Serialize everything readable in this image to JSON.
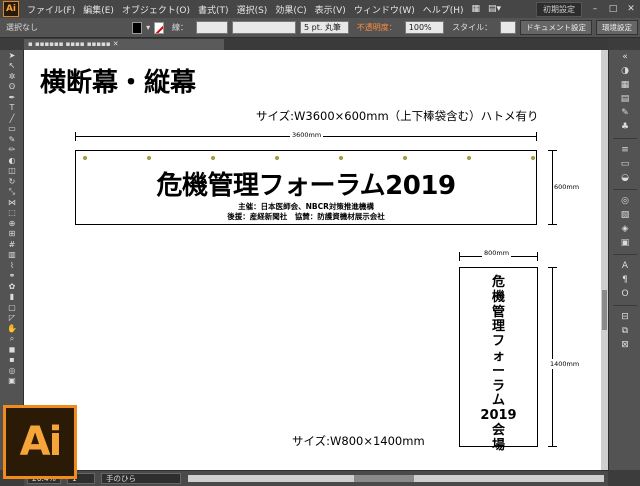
{
  "app": {
    "logo": "Ai"
  },
  "menu": {
    "items": [
      "ファイル(F)",
      "編集(E)",
      "オブジェクト(O)",
      "書式(T)",
      "選択(S)",
      "効果(C)",
      "表示(V)",
      "ウィンドウ(W)",
      "ヘルプ(H)"
    ],
    "workspace": "初期設定"
  },
  "control": {
    "selection": "選択なし",
    "stroke_label": "線：",
    "brush": "5 pt. 丸筆",
    "opacity_label": "不透明度：",
    "opacity": "100%",
    "style_label": "スタイル：",
    "doc_setup": "ドキュメント設定",
    "prefs": "環境設定"
  },
  "status": {
    "zoom": "26.4%",
    "page": "1",
    "tool": "手のひら"
  },
  "artwork": {
    "section_title": "横断幕・縦幕",
    "horizontal": {
      "size_label": "サイズ:W3600×600mm（上下棒袋含む）ハトメ有り",
      "width_dim": "3600mm",
      "height_dim": "600mm",
      "main": "危機管理フォーラム2019",
      "line1": "主催：日本医師会、NBCR対策推進機構",
      "line2": "後援：産経新聞社　協賛：防護資機材展示会社"
    },
    "vertical": {
      "width_dim": "800mm",
      "height_dim": "1400mm",
      "chars": [
        "危",
        "機",
        "管",
        "理",
        "フ",
        "ォ",
        "ー",
        "ラ",
        "ム",
        "2019",
        "会",
        "場"
      ],
      "size_label": "サイズ:W800×1400mm"
    }
  },
  "colors": {
    "accent": "#f08c1e",
    "ui_bg": "#535353",
    "grommet": "#a29a3c"
  }
}
